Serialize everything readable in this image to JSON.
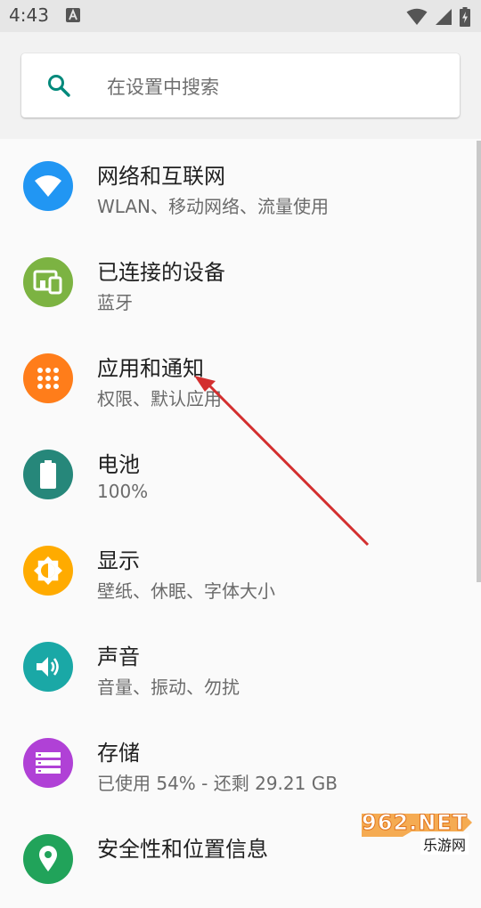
{
  "status_bar": {
    "time": "4:43",
    "notification_icon": "a-letter-icon",
    "status_icons": [
      "wifi-icon",
      "signal-icon",
      "battery-charging-icon"
    ]
  },
  "search": {
    "placeholder": "在设置中搜索",
    "icon": "search-icon",
    "accent": "#00897b"
  },
  "settings_items": [
    {
      "title": "网络和互联网",
      "subtitle": "WLAN、移动网络、流量使用",
      "icon": "wifi-icon",
      "color": "#2196f3"
    },
    {
      "title": "已连接的设备",
      "subtitle": "蓝牙",
      "icon": "devices-icon",
      "color": "#7cb342"
    },
    {
      "title": "应用和通知",
      "subtitle": "权限、默认应用",
      "icon": "apps-grid-icon",
      "color": "#ff7d1a"
    },
    {
      "title": "电池",
      "subtitle": "100%",
      "icon": "battery-icon",
      "color": "#26877a"
    },
    {
      "title": "显示",
      "subtitle": "壁纸、休眠、字体大小",
      "icon": "brightness-icon",
      "color": "#ffab00"
    },
    {
      "title": "声音",
      "subtitle": "音量、振动、勿扰",
      "icon": "volume-icon",
      "color": "#1aa8a6"
    },
    {
      "title": "存储",
      "subtitle": "已使用 54% - 还剩 29.21 GB",
      "icon": "storage-icon",
      "color": "#b041d6"
    },
    {
      "title": "安全性和位置信息",
      "subtitle": "",
      "icon": "location-icon",
      "color": "#21a35a"
    }
  ],
  "annotation": {
    "color": "#d32f2f"
  },
  "watermark": {
    "top": "962.NET",
    "bottom": "乐游网"
  }
}
